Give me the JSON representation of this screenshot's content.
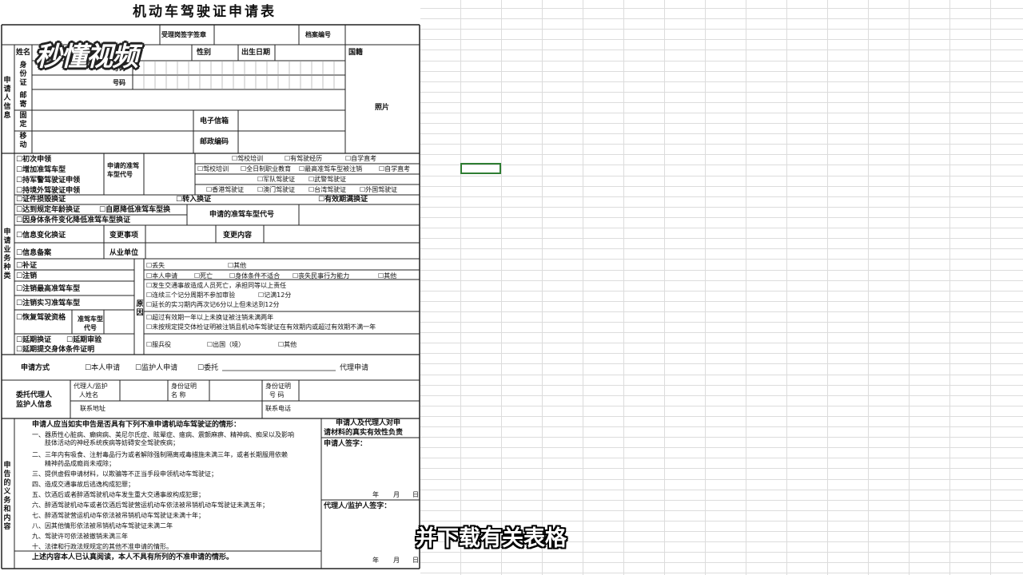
{
  "form": {
    "title": "机动车驾驶证申请表",
    "header": {
      "acceptor_sign": "受理岗签字签章",
      "archive_no": "档案编号"
    },
    "applicant": {
      "section_label": "申请人信息",
      "name": "姓名",
      "gender": "性别",
      "birth": "出生日期",
      "nationality": "国籍",
      "id_label": "身份证",
      "id_code_1": "号码",
      "id_code_2": "号码",
      "mail_label": "邮寄",
      "fixed_label": "固定",
      "mobile_label": "移动",
      "email": "电子信箱",
      "postcode": "邮政编码",
      "photo": "照片"
    },
    "business": {
      "section_label": "申请业务种类",
      "first_apply": "☐初次申领",
      "add_type": "☐增加准驾车型",
      "military": "☐持军警驾驶证申领",
      "overseas": "☐持境外驾驶证申领",
      "apply_type_code": "申请的准驾车型代号",
      "opt_school": "☐驾校培训",
      "opt_exp": "☐有驾驶经历",
      "opt_self": "☐自学直考",
      "opt_school2": "☐驾校培训",
      "opt_fulltime": "☐全日制职业教育",
      "opt_highest": "☐最高准驾车型被注销",
      "opt_self2": "☐自学直考",
      "opt_army": "☐军队驾驶证",
      "opt_police": "☐武警驾驶证",
      "opt_hk": "☐香港驾驶证",
      "opt_macau": "☐澳门驾驶证",
      "opt_tw": "☐台湾驾驶证",
      "opt_foreign": "☐外国驾驶证",
      "renew_damage": "☐证件损毁换证",
      "transfer": "☐转入换证",
      "expire": "☐有效期满换证",
      "age_renew": "☐达到规定年龄换证",
      "self_downgrade": "☐自愿降低准驾车型换",
      "body_downgrade": "☐因身体条件变化降低准驾车型换证",
      "apply_type_code2": "申请的准驾车型代号",
      "info_change": "☐信息变化换证",
      "change_item": "变更事项",
      "change_content": "变更内容",
      "info_record": "☐信息备案",
      "employer": "从业单位",
      "reissue": "☐补证",
      "cancel": "☐注销",
      "cancel_high": "☐注销最高准驾车型",
      "cancel_intern": "☐注销实习准驾车型",
      "reason_label": "原因",
      "r_lost": "☐丢失",
      "r_other1": "☐其他",
      "r_self": "☐本人申请",
      "r_death": "☐死亡",
      "r_body": "☐身体条件不适合",
      "r_civil": "☐丧失民事行为能力",
      "r_other2": "☐其他",
      "r_accident": "☐发生交通事故造成人员死亡，承担同等以上责任",
      "r_points": "☐连续三个记分周期不参加审验",
      "r_full12": "☐记满12分",
      "r_intern": "☐延长的实习期内再次记6分以上但未达到12分",
      "restore": "☐恢复驾驶资格",
      "restore_type": "准驾车型代号",
      "r_over1": "☐超过有效期一年以上未换证被注销未满两年",
      "r_over2": "☐未按规定提交体检证明被注销且机动车驾驶证在有效期内或超过有效期不满一年",
      "delay_renew": "☐延期换证",
      "delay_review": "☐延期审验",
      "delay_body": "☐延期提交身体条件证明",
      "r_military": "☐服兵役",
      "r_abroad": "☐出国（境）",
      "r_other3": "☐其他"
    },
    "method": {
      "label": "申请方式",
      "self": "☐本人申请",
      "guardian": "☐监护人申请",
      "entrust": "☐委托",
      "agent": "代理申请"
    },
    "agent": {
      "label1": "委托代理人",
      "label2": "监护人信息",
      "name1": "代理人/监护",
      "name2": "人姓名",
      "idname1": "身份证明",
      "idname2": "名    称",
      "idno1": "身份证明",
      "idno2": "号    码",
      "address": "联系地址",
      "phone": "联系电话"
    },
    "declaration": {
      "section_label": "申告的义务和内容",
      "heading": "申请人应当如实申告是否具有下列不准申请机动车驾驶证的情形：",
      "items": [
        "一、器质性心脏病、癫痫病、美尼尔氏症、眩晕症、癔病、震颤麻痹、精神病、痴呆以及影响",
        "肢体活动的神经系统疾病等妨碍安全驾驶疾病；",
        "二、三年内有吸食、注射毒品行为或者解除强制隔离戒毒措施未满三年，或者长期服用依赖",
        "精神药品成瘾尚未戒除；",
        "三、提供虚假申请材料，以欺骗等不正当手段申领机动车驾驶证；",
        "四、造成交通事故后逃逸构成犯罪；",
        "五、饮酒后或者醉酒驾驶机动车发生重大交通事故构成犯罪；",
        "六、醉酒驾驶机动车或者饮酒后驾驶营运机动车依法被吊销机动车驾驶证未满五年；",
        "七、醉酒驾驶营运机动车依法被吊销机动车驾驶证未满十年；",
        "八、因其他情形依法被吊销机动车驾驶证未满二年",
        "九、驾驶许可依法被撤销未满三年",
        "十、法律和行政法规规定的其他不准申请的情形。"
      ],
      "footer": "上述内容本人已认真阅读，本人不具有所列的不准申请的情形。",
      "resp1": "申请人及代理人对申",
      "resp2": "请材料的真实有效性负责",
      "sign_applicant": "申请人签字：",
      "year": "年",
      "month": "月",
      "day": "日",
      "sign_agent": "代理人/监护人签字："
    }
  },
  "overlay": {
    "logo": "秒懂视频",
    "subtitle": "并下载有关表格"
  }
}
